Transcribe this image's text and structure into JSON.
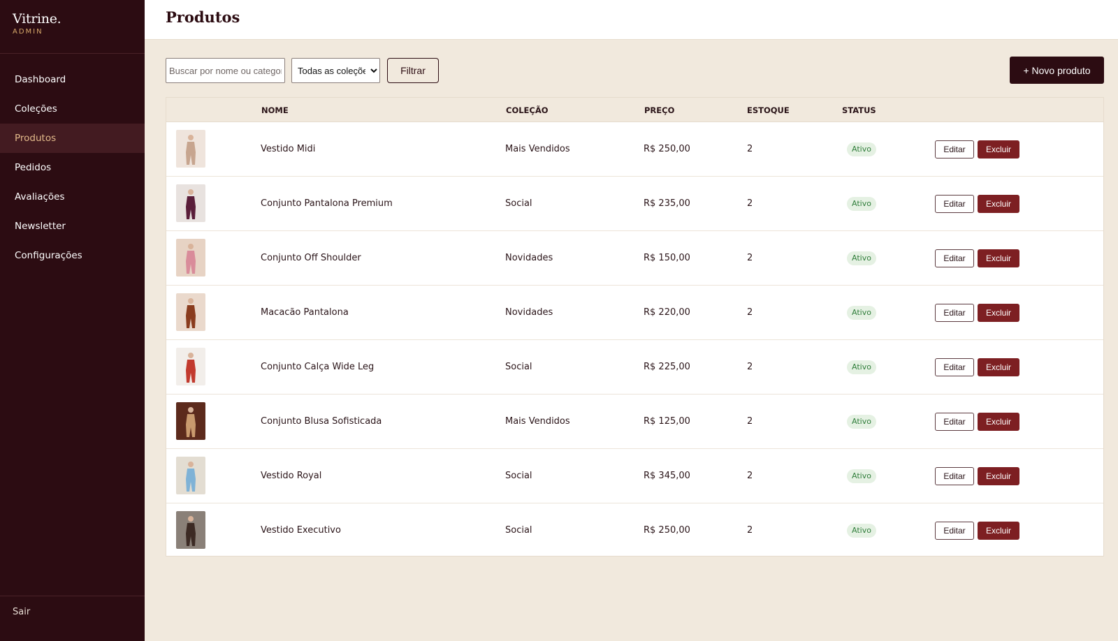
{
  "brand": {
    "name": "Vitrine.",
    "sub": "ADMIN"
  },
  "nav": [
    {
      "label": "Dashboard",
      "active": false
    },
    {
      "label": "Coleções",
      "active": false
    },
    {
      "label": "Produtos",
      "active": true
    },
    {
      "label": "Pedidos",
      "active": false
    },
    {
      "label": "Avaliações",
      "active": false
    },
    {
      "label": "Newsletter",
      "active": false
    },
    {
      "label": "Configurações",
      "active": false
    }
  ],
  "logout_label": "Sair",
  "page_title": "Produtos",
  "toolbar": {
    "search_placeholder": "Buscar por nome ou categoria",
    "collection_select": "Todas as coleções",
    "filter_label": "Filtrar",
    "new_product_label": "+ Novo produto"
  },
  "table": {
    "headers": {
      "name": "NOME",
      "collection": "COLEÇÃO",
      "price": "PREÇO",
      "stock": "ESTOQUE",
      "status": "STATUS"
    },
    "edit_label": "Editar",
    "delete_label": "Excluir",
    "rows": [
      {
        "name": "Vestido Midi",
        "collection": "Mais Vendidos",
        "price": "R$ 250,00",
        "stock": "2",
        "status": "Ativo",
        "thumb_bg": "#efe4dc",
        "thumb_fig": "#c7a58f"
      },
      {
        "name": "Conjunto Pantalona Premium",
        "collection": "Social",
        "price": "R$ 235,00",
        "stock": "2",
        "status": "Ativo",
        "thumb_bg": "#e8e2df",
        "thumb_fig": "#5a1e3a"
      },
      {
        "name": "Conjunto Off Shoulder",
        "collection": "Novidades",
        "price": "R$ 150,00",
        "stock": "2",
        "status": "Ativo",
        "thumb_bg": "#e7d3c4",
        "thumb_fig": "#d98c9a"
      },
      {
        "name": "Macacão Pantalona",
        "collection": "Novidades",
        "price": "R$ 220,00",
        "stock": "2",
        "status": "Ativo",
        "thumb_bg": "#ead9cc",
        "thumb_fig": "#8a3c1e"
      },
      {
        "name": "Conjunto Calça Wide Leg",
        "collection": "Social",
        "price": "R$ 225,00",
        "stock": "2",
        "status": "Ativo",
        "thumb_bg": "#f2eeea",
        "thumb_fig": "#c23a2e"
      },
      {
        "name": "Conjunto Blusa Sofisticada",
        "collection": "Mais Vendidos",
        "price": "R$ 125,00",
        "stock": "2",
        "status": "Ativo",
        "thumb_bg": "#5c2a1c",
        "thumb_fig": "#c99a6e"
      },
      {
        "name": "Vestido Royal",
        "collection": "Social",
        "price": "R$ 345,00",
        "stock": "2",
        "status": "Ativo",
        "thumb_bg": "#e3ddd2",
        "thumb_fig": "#7fb2d6"
      },
      {
        "name": "Vestido Executivo",
        "collection": "Social",
        "price": "R$ 250,00",
        "stock": "2",
        "status": "Ativo",
        "thumb_bg": "#8a8078",
        "thumb_fig": "#3c2a24"
      }
    ]
  },
  "colors": {
    "sidebar": "#2c0c12",
    "accent": "#7d1f22",
    "background": "#f1e9dd",
    "badge_bg": "#e5f1e3",
    "badge_text": "#2f7d3a"
  }
}
